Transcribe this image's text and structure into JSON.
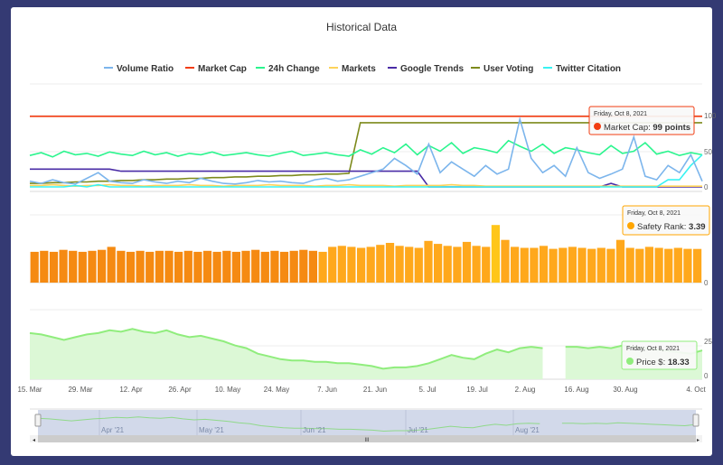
{
  "chart_data": [
    {
      "type": "line",
      "title": "Historical Data",
      "x_axis": {
        "type": "ordinal-date",
        "tick_labels": [
          "15. Mar",
          "29. Mar",
          "12. Apr",
          "26. Apr",
          "10. May",
          "24. May",
          "7. Jun",
          "21. Jun",
          "5. Jul",
          "19. Jul",
          "2. Aug",
          "16. Aug",
          "30. Aug",
          "4. Oct"
        ]
      },
      "y_ticks": [
        "100",
        "50",
        "0"
      ],
      "ylim": [
        0,
        100
      ],
      "legend_position": "top",
      "series": [
        {
          "name": "Volume Ratio",
          "color": "#7cb5ec",
          "values": [
            8,
            5,
            10,
            6,
            4,
            12,
            20,
            8,
            6,
            5,
            10,
            7,
            5,
            8,
            6,
            12,
            8,
            5,
            4,
            6,
            9,
            7,
            8,
            6,
            5,
            10,
            12,
            8,
            10,
            15,
            20,
            25,
            40,
            30,
            18,
            60,
            20,
            35,
            25,
            15,
            30,
            18,
            25,
            95,
            40,
            20,
            30,
            15,
            55,
            20,
            12,
            18,
            25,
            70,
            15,
            10,
            30,
            20,
            45,
            8
          ]
        },
        {
          "name": "Market Cap",
          "color": "#f23d12",
          "values": [
            99,
            99,
            99,
            99,
            99,
            99,
            99,
            99,
            99,
            99,
            99,
            99,
            99,
            99,
            99,
            99,
            99,
            99,
            99,
            99,
            99,
            99,
            99,
            99,
            99,
            99,
            99,
            99,
            99,
            99,
            99,
            99,
            99,
            99,
            99,
            99,
            99,
            99,
            99,
            99,
            99,
            99,
            99,
            99,
            99,
            99,
            99,
            99,
            99,
            99,
            99,
            99,
            99,
            99,
            99,
            99,
            99,
            99,
            99,
            99
          ]
        },
        {
          "name": "24h Change",
          "color": "#2bf58e",
          "values": [
            44,
            48,
            42,
            50,
            45,
            47,
            43,
            49,
            46,
            44,
            50,
            45,
            48,
            43,
            47,
            45,
            49,
            44,
            46,
            48,
            45,
            43,
            47,
            50,
            44,
            46,
            48,
            45,
            43,
            52,
            46,
            55,
            48,
            60,
            45,
            58,
            50,
            62,
            47,
            55,
            52,
            48,
            65,
            57,
            50,
            60,
            47,
            55,
            52,
            48,
            45,
            58,
            47,
            50,
            62,
            46,
            50,
            44,
            48,
            45
          ]
        },
        {
          "name": "Markets",
          "color": "#fdd35a",
          "values": [
            2,
            2,
            3,
            2,
            1,
            2,
            2,
            3,
            2,
            2,
            1,
            2,
            2,
            2,
            3,
            2,
            2,
            1,
            2,
            2,
            2,
            3,
            2,
            2,
            2,
            1,
            2,
            2,
            3,
            2,
            2,
            2,
            1,
            2,
            2,
            2,
            2,
            3,
            2,
            2,
            1,
            1,
            1,
            1,
            1,
            1,
            1,
            1,
            1,
            1,
            1,
            1,
            1,
            1,
            1,
            1,
            1,
            1,
            1,
            1
          ]
        },
        {
          "name": "Google Trends",
          "color": "#4a2ca6",
          "values": [
            25,
            25,
            25,
            25,
            25,
            25,
            25,
            25,
            22,
            22,
            22,
            22,
            22,
            22,
            22,
            22,
            22,
            22,
            22,
            22,
            22,
            22,
            22,
            22,
            22,
            22,
            22,
            22,
            22,
            22,
            22,
            22,
            22,
            22,
            22,
            0,
            0,
            0,
            0,
            0,
            0,
            0,
            0,
            0,
            0,
            0,
            0,
            0,
            0,
            0,
            0,
            5,
            0,
            0,
            0,
            0,
            0,
            0,
            0,
            0
          ]
        },
        {
          "name": "User Voting",
          "color": "#7d8a1c",
          "values": [
            5,
            5,
            6,
            6,
            7,
            7,
            8,
            8,
            9,
            9,
            10,
            10,
            11,
            11,
            12,
            12,
            13,
            13,
            14,
            14,
            15,
            15,
            16,
            16,
            17,
            17,
            18,
            18,
            19,
            90,
            90,
            90,
            90,
            90,
            90,
            90,
            90,
            90,
            90,
            90,
            90,
            90,
            90,
            90,
            90,
            90,
            90,
            90,
            90,
            90,
            90,
            90,
            90,
            90,
            90,
            90,
            90,
            90,
            90,
            90
          ]
        },
        {
          "name": "Twitter Citation",
          "color": "#38f2f2",
          "values": [
            0,
            0,
            0,
            0,
            2,
            0,
            3,
            0,
            0,
            0,
            0,
            0,
            0,
            0,
            0,
            0,
            0,
            0,
            0,
            0,
            0,
            0,
            0,
            0,
            0,
            0,
            0,
            0,
            0,
            0,
            0,
            0,
            0,
            0,
            0,
            0,
            0,
            0,
            0,
            0,
            0,
            0,
            0,
            0,
            0,
            0,
            0,
            0,
            0,
            0,
            0,
            0,
            0,
            0,
            0,
            0,
            10,
            10,
            30,
            45
          ]
        }
      ],
      "tooltip": {
        "date": "Friday, Oct 8, 2021",
        "label": "Market Cap: ",
        "value": "99 points",
        "color": "#f23d12"
      }
    },
    {
      "type": "bar",
      "series": [
        {
          "name": "Safety Rank",
          "color": "#ffa500",
          "values": [
            3.1,
            3.2,
            3.1,
            3.3,
            3.2,
            3.1,
            3.2,
            3.3,
            3.6,
            3.2,
            3.1,
            3.2,
            3.1,
            3.2,
            3.2,
            3.1,
            3.2,
            3.1,
            3.2,
            3.1,
            3.2,
            3.1,
            3.2,
            3.3,
            3.1,
            3.2,
            3.1,
            3.2,
            3.3,
            3.2,
            3.1,
            3.6,
            3.7,
            3.6,
            3.5,
            3.6,
            3.8,
            4.0,
            3.7,
            3.6,
            3.5,
            4.2,
            3.9,
            3.7,
            3.6,
            4.1,
            3.7,
            3.6,
            5.8,
            4.3,
            3.6,
            3.5,
            3.5,
            3.7,
            3.4,
            3.5,
            3.6,
            3.5,
            3.4,
            3.5,
            3.4,
            4.3,
            3.5,
            3.4,
            3.6,
            3.5,
            3.4,
            3.5,
            3.4,
            3.39
          ]
        }
      ],
      "y_ticks": [
        "0"
      ],
      "tooltip": {
        "date": "Friday, Oct 8, 2021",
        "label": "Safety Rank: ",
        "value": "3.39",
        "color": "#ffa500"
      }
    },
    {
      "type": "area",
      "series": [
        {
          "name": "Price $",
          "color": "#90ed7d",
          "values": [
            31,
            30,
            28,
            26,
            28,
            30,
            31,
            33,
            32,
            34,
            32,
            31,
            33,
            30,
            28,
            29,
            27,
            25,
            22,
            20,
            16,
            14,
            12,
            11,
            11,
            10,
            10,
            9,
            9,
            8,
            7,
            5,
            6,
            6,
            7,
            9,
            12,
            15,
            13,
            12,
            16,
            19,
            17,
            20,
            21,
            20,
            null,
            21,
            21,
            20,
            21,
            20,
            22,
            21,
            20,
            19,
            18,
            17,
            16,
            18.33
          ]
        }
      ],
      "y_ticks": [
        "25",
        "0"
      ],
      "tooltip": {
        "date": "Friday, Oct 8, 2021",
        "label": "Price $: ",
        "value": "18.33",
        "color": "#90ed7d"
      }
    }
  ],
  "navigator": {
    "labels": [
      "Apr '21",
      "May '21",
      "Jun '21",
      "Jul '21",
      "Aug '21"
    ],
    "scrollbar_grip": "III"
  }
}
